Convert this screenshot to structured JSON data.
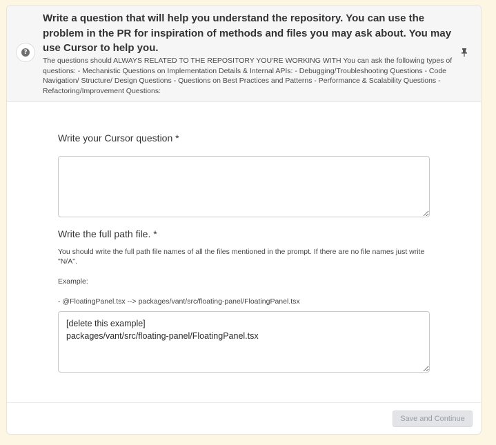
{
  "header": {
    "title": "Write a question that will help you understand the repository. You can use the problem in the PR for inspiration of methods and files you may ask about. You may use Cursor to help you.",
    "description": "The questions should ALWAYS RELATED TO THE REPOSITORY YOU'RE WORKING WITH You can ask the following types of questions: - Mechanistic Questions on Implementation Details & Internal APIs: - Debugging/Troubleshooting Questions - Code Navigation/ Structure/ Design Questions - Questions on Best Practices and Patterns - Performance & Scalability Questions - Refactoring/Improvement Questions:",
    "help_icon": "question-circle-icon",
    "pin_icon": "pin-icon"
  },
  "question_field": {
    "label": "Write your Cursor question *",
    "value": ""
  },
  "path_field": {
    "label": "Write the full path file. *",
    "help": "You should write the full path file names of all the files mentioned in the prompt. If there are no file names just write \"N/A\".",
    "example_label": "Example:",
    "example": "- @FloatingPanel.tsx --> packages/vant/src/floating-panel/FloatingPanel.tsx",
    "value": "[delete this example]\npackages/vant/src/floating-panel/FloatingPanel.tsx"
  },
  "footer": {
    "save_label": "Save and Continue"
  },
  "colors": {
    "page_background": "#fdf6e3",
    "header_background": "#f6f6f6",
    "disabled_button": "#e3e4e7",
    "disabled_button_text": "#9a9ea5"
  }
}
